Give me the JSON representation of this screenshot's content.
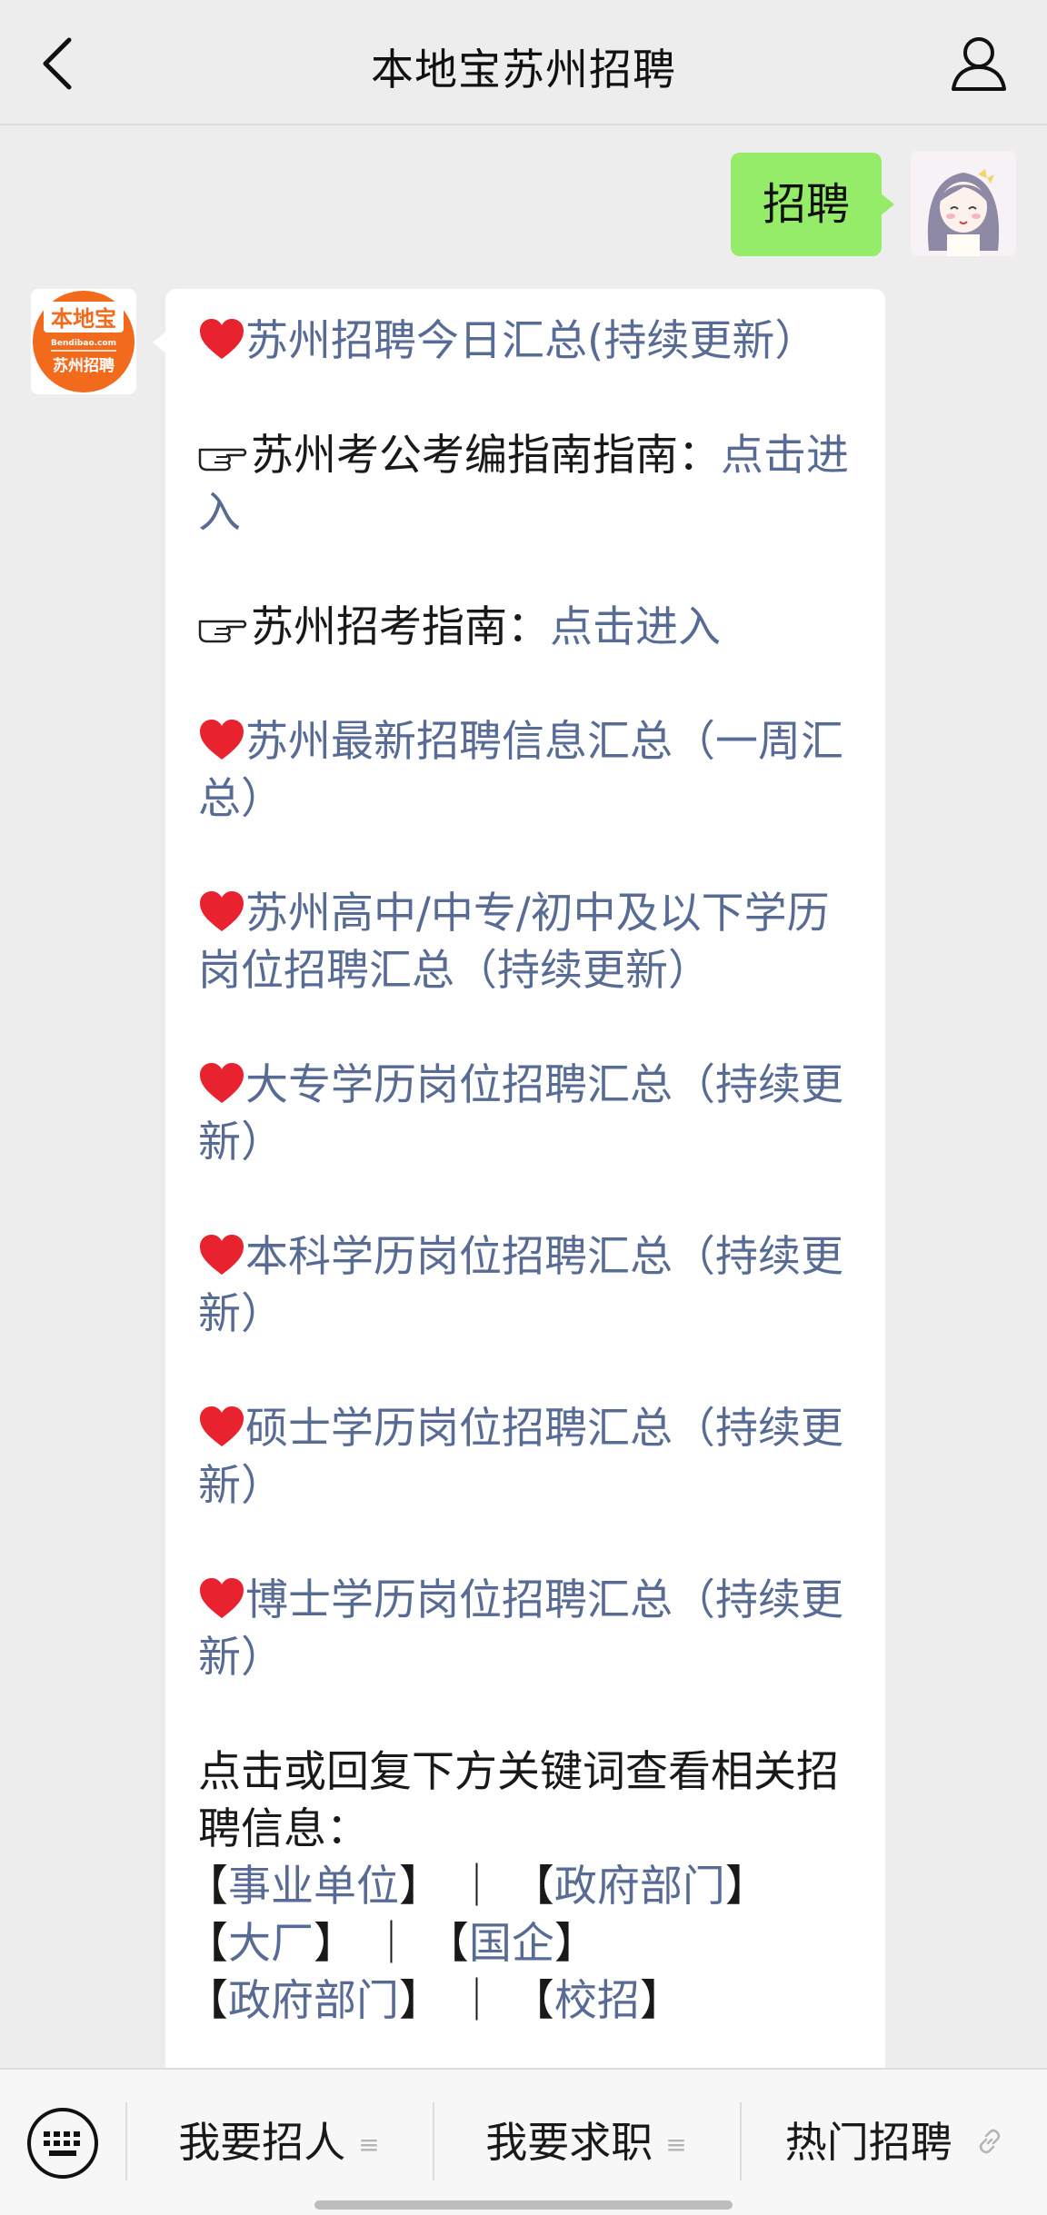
{
  "header": {
    "title": "本地宝苏州招聘"
  },
  "sent_message": {
    "text": "招聘"
  },
  "bot_avatar": {
    "logo_text": "本地宝",
    "domain_text": "Bendibao.com",
    "sub_text": "苏州招聘"
  },
  "received_message": {
    "items": [
      {
        "icon": "heart",
        "link": "苏州招聘今日汇总(持续更新）"
      },
      {
        "icon": "hand",
        "prefix": "苏州考公考编指南指南：",
        "link": "点击进入"
      },
      {
        "icon": "hand",
        "prefix": "苏州招考指南：",
        "link": "点击进入"
      },
      {
        "icon": "heart",
        "link": "苏州最新招聘信息汇总（一周汇总）"
      },
      {
        "icon": "heart",
        "link": "苏州高中/中专/初中及以下学历岗位招聘汇总（持续更新）"
      },
      {
        "icon": "heart",
        "link": "大专学历岗位招聘汇总（持续更新）"
      },
      {
        "icon": "heart",
        "link": "本科学历岗位招聘汇总（持续更新）"
      },
      {
        "icon": "heart",
        "link": "硕士学历岗位招聘汇总（持续更新）"
      },
      {
        "icon": "heart",
        "link": "博士学历岗位招聘汇总（持续更新）"
      }
    ],
    "keywords_intro": "点击或回复下方关键词查看相关招聘信息：",
    "keyword_sep": "｜",
    "keywords": {
      "k1": "事业单位",
      "k2": "政府部门",
      "k3": "大厂",
      "k4": "国企",
      "k5": "政府部门",
      "k6": "校招"
    },
    "bracket_open": "【",
    "bracket_close": "】"
  },
  "bottom_menu": {
    "items": [
      {
        "label": "我要招人",
        "icon": "submenu"
      },
      {
        "label": "我要求职",
        "icon": "submenu"
      },
      {
        "label": "热门招聘",
        "icon": "link"
      }
    ]
  },
  "colors": {
    "background": "#ededed",
    "sent_bubble": "#95ec69",
    "link": "#576b95",
    "heart": "#e8222f",
    "logo_orange": "#f26b1d"
  }
}
